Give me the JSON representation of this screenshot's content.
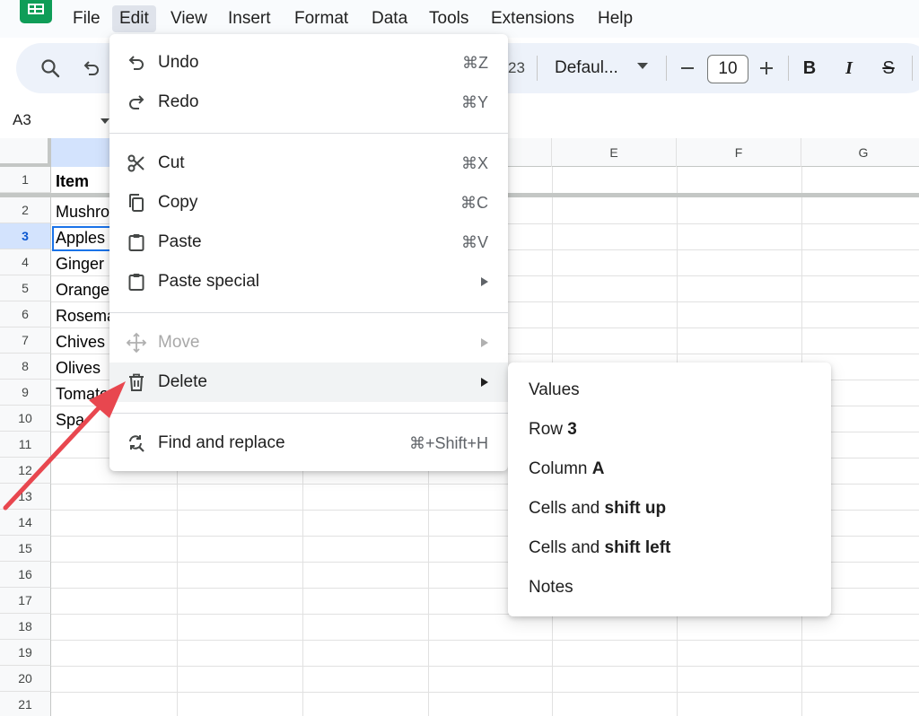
{
  "menubar": {
    "items": [
      "File",
      "Edit",
      "View",
      "Insert",
      "Format",
      "Data",
      "Tools",
      "Extensions",
      "Help"
    ],
    "open_item": "Edit"
  },
  "toolbar": {
    "zoom_fragment": "23",
    "font_name": "Defaul...",
    "font_size": "10",
    "bold_label": "B",
    "italic_label": "I",
    "strike_label": "S"
  },
  "namebox": {
    "value": "A3"
  },
  "grid": {
    "column_headers": [
      "E",
      "F",
      "G"
    ],
    "row_numbers": [
      "1",
      "2",
      "3",
      "4",
      "5",
      "6",
      "7",
      "8",
      "9",
      "10",
      "11",
      "12",
      "13",
      "14",
      "15",
      "16",
      "17",
      "18",
      "19",
      "20",
      "21"
    ],
    "selected_row": "3",
    "cells": [
      "Item",
      "Mushro",
      "Apples",
      "Ginger",
      "Orange",
      "Rosema",
      "Chives",
      "Olives",
      "Tomato",
      "Spa"
    ]
  },
  "edit_menu": {
    "undo": {
      "label": "Undo",
      "shortcut": "⌘Z"
    },
    "redo": {
      "label": "Redo",
      "shortcut": "⌘Y"
    },
    "cut": {
      "label": "Cut",
      "shortcut": "⌘X"
    },
    "copy": {
      "label": "Copy",
      "shortcut": "⌘C"
    },
    "paste": {
      "label": "Paste",
      "shortcut": "⌘V"
    },
    "paste_special": {
      "label": "Paste special"
    },
    "move": {
      "label": "Move"
    },
    "delete": {
      "label": "Delete"
    },
    "find_replace": {
      "label": "Find and replace",
      "shortcut": "⌘+Shift+H"
    }
  },
  "delete_submenu": {
    "values": "Values",
    "row_prefix": "Row ",
    "row_value": "3",
    "column_prefix": "Column ",
    "column_value": "A",
    "shift_up_prefix": "Cells and ",
    "shift_up_bold": "shift up",
    "shift_left_prefix": "Cells and ",
    "shift_left_bold": "shift left",
    "notes": "Notes"
  },
  "colors": {
    "accent": "#1a73e8",
    "arrow": "#e8474f",
    "menu_active": "#dfe3eb",
    "brand_green": "#0f9d58"
  }
}
